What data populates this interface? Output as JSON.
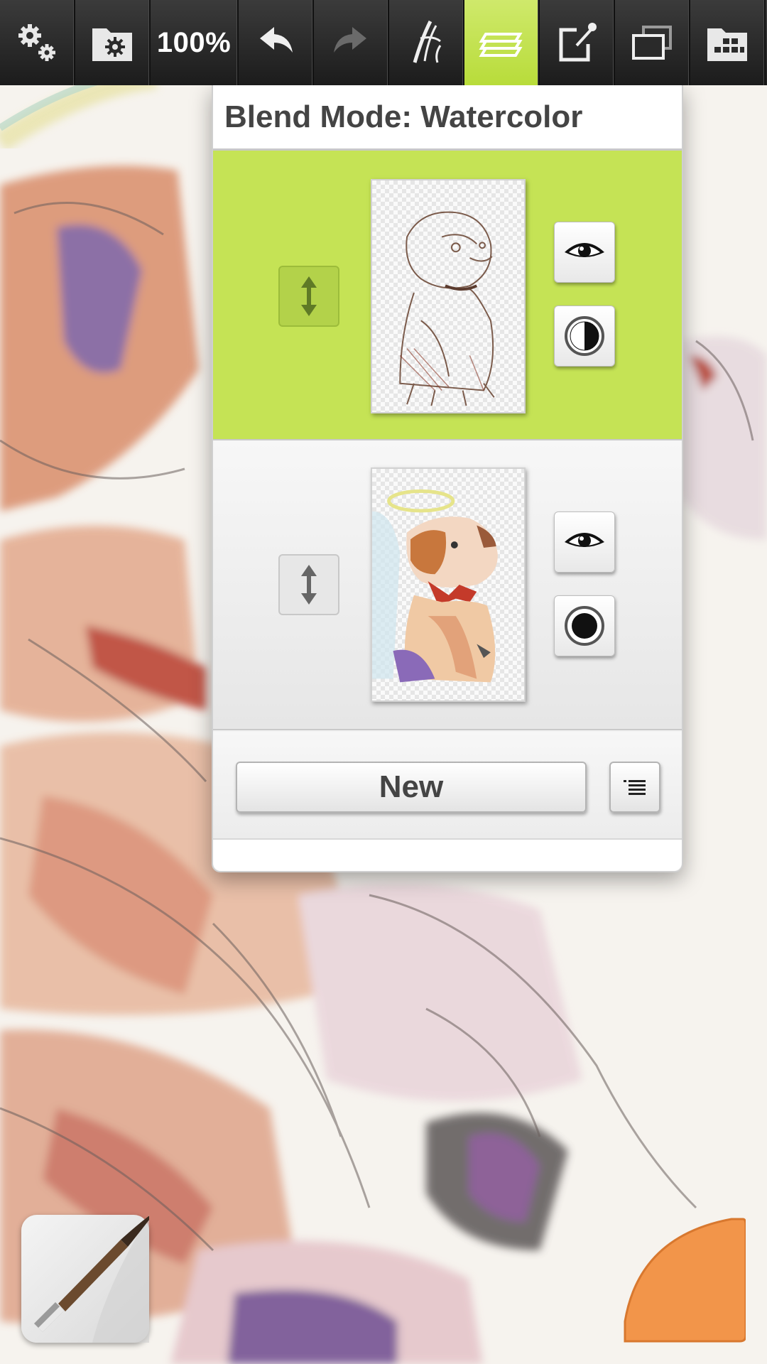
{
  "toolbar": {
    "zoom_label": "100%",
    "buttons": [
      {
        "name": "settings",
        "icon": "gears-icon"
      },
      {
        "name": "gallery",
        "icon": "folder-gear-icon"
      },
      {
        "name": "zoom",
        "icon": "zoom-level"
      },
      {
        "name": "undo",
        "icon": "undo-arrow-icon"
      },
      {
        "name": "redo",
        "icon": "redo-arrow-icon",
        "disabled": true
      },
      {
        "name": "brush-tools",
        "icon": "brush-stroke-icon"
      },
      {
        "name": "layers",
        "icon": "layers-icon",
        "active": true
      },
      {
        "name": "export",
        "icon": "share-edit-icon"
      },
      {
        "name": "canvas",
        "icon": "canvas-windows-icon"
      },
      {
        "name": "reference",
        "icon": "folder-grid-icon"
      }
    ],
    "active_color": "#c5e355"
  },
  "layers_panel": {
    "title": "Blend Mode: Watercolor",
    "layers": [
      {
        "name": "sketch-layer",
        "selected": true,
        "visible": true,
        "opacity_icon": "half-circle-icon"
      },
      {
        "name": "paint-layer",
        "selected": false,
        "visible": true,
        "opacity_icon": "full-circle-icon"
      }
    ],
    "new_button_label": "New",
    "menu_icon": "list-menu-icon"
  },
  "bottom": {
    "brush_icon": "paintbrush-icon",
    "color_swatch": "#f2954a"
  }
}
